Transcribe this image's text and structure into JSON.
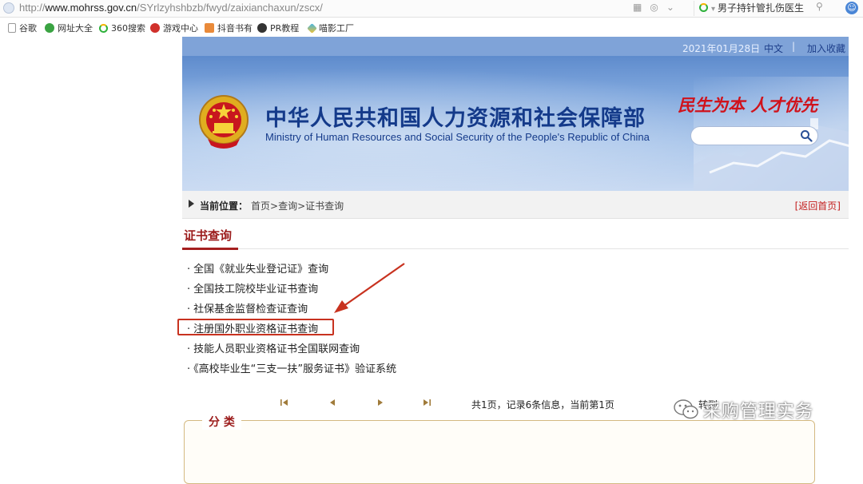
{
  "browser": {
    "url_prefix": "http://",
    "url_domain": "www.mohrss.gov.cn",
    "url_path": "/SYrlzyhshbzb/fwyd/zaixianchaxun/zscx/",
    "search_text": "男子持针管扎伤医生"
  },
  "bookmarks": [
    {
      "label": "谷歌",
      "icon": "page-icon"
    },
    {
      "label": "网址大全",
      "icon": "globe-icon"
    },
    {
      "label": "360搜索",
      "icon": "360-search-icon"
    },
    {
      "label": "游戏中心",
      "icon": "game-icon"
    },
    {
      "label": "抖音书有",
      "icon": "book-icon"
    },
    {
      "label": "PR教程",
      "icon": "pr-icon"
    },
    {
      "label": "喵影工厂",
      "icon": "cat-icon"
    }
  ],
  "header": {
    "date": "2021年01月28日",
    "lang": "中文",
    "separator": "|",
    "favorite": "加入收藏",
    "title_cn": "中华人民共和国人力资源和社会保障部",
    "title_en": "Ministry of Human Resources and Social Security of the People's Republic of China",
    "slogan": "民生为本  人才优先",
    "search_placeholder": ""
  },
  "breadcrumb": {
    "label": "当前位置：",
    "items": [
      "首页",
      "查询",
      "证书查询"
    ],
    "sep": ">",
    "back": "[返回首页]"
  },
  "section": {
    "title": "证书查询",
    "links": [
      "全国《就业失业登记证》查询",
      "全国技工院校毕业证书查询",
      "社保基金监督检查证查询",
      "注册国外职业资格证书查询",
      "技能人员职业资格证书全国联网查询",
      "《高校毕业生“三支一扶”服务证书》验证系统"
    ],
    "highlighted_index": 3
  },
  "pager": {
    "info": "共1页，记录6条信息，当前第1页",
    "goto": "转到"
  },
  "category": {
    "title": "分 类"
  },
  "watermark": {
    "text": "采购管理实务"
  },
  "colors": {
    "title_blue": "#143a8a",
    "slogan_red": "#d0121b",
    "section_red": "#9b1b1b",
    "highlight_red": "#c8321f"
  }
}
